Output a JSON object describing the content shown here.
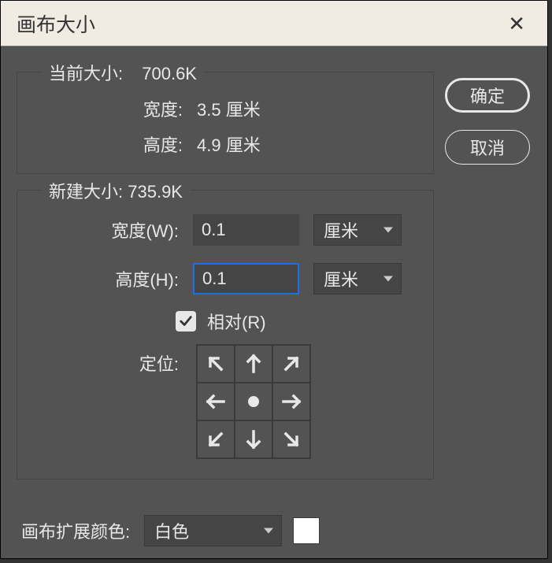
{
  "dialog": {
    "title": "画布大小"
  },
  "current": {
    "legend_label": "当前大小:",
    "legend_value": "700.6K",
    "width_label": "宽度:",
    "width_value": "3.5 厘米",
    "height_label": "高度:",
    "height_value": "4.9 厘米"
  },
  "newsize": {
    "legend_label": "新建大小:",
    "legend_value": "735.9K",
    "width_label": "宽度(W):",
    "width_value": "0.1",
    "width_unit": "厘米",
    "height_label": "高度(H):",
    "height_value": "0.1",
    "height_unit": "厘米",
    "relative_label": "相对(R)",
    "relative_checked": true,
    "anchor_label": "定位:"
  },
  "extension": {
    "label": "画布扩展颜色:",
    "selected": "白色",
    "swatch_color": "#ffffff"
  },
  "buttons": {
    "ok": "确定",
    "cancel": "取消"
  }
}
